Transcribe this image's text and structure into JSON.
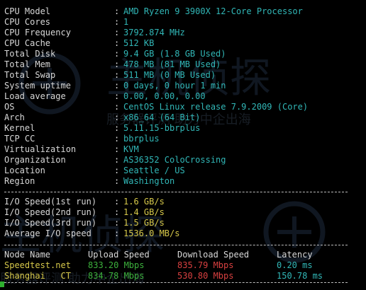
{
  "colors": {
    "background": "#000000",
    "label": "#d8d8d8",
    "value_cyan": "#31b7b7",
    "value_yellow": "#d6c84a",
    "value_green": "#3cb03c",
    "value_red": "#d84040"
  },
  "sysinfo": [
    {
      "label": "CPU Model",
      "value": "AMD Ryzen 9 3900X 12-Core Processor"
    },
    {
      "label": "CPU Cores",
      "value": "1"
    },
    {
      "label": "CPU Frequency",
      "value": "3792.874 MHz"
    },
    {
      "label": "CPU Cache",
      "value": "512 KB"
    },
    {
      "label": "Total Disk",
      "value": "9.4 GB (1.8 GB Used)"
    },
    {
      "label": "Total Mem",
      "value": "478 MB (81 MB Used)"
    },
    {
      "label": "Total Swap",
      "value": "511 MB (0 MB Used)"
    },
    {
      "label": "System uptime",
      "value": "0 days, 0 hour 1 min"
    },
    {
      "label": "Load average",
      "value": "0.00, 0.00, 0.00"
    },
    {
      "label": "OS",
      "value": "CentOS Linux release 7.9.2009 (Core)"
    },
    {
      "label": "Arch",
      "value": "x86_64 (64 Bit)"
    },
    {
      "label": "Kernel",
      "value": "5.11.15-bbrplus"
    },
    {
      "label": "TCP CC",
      "value": "bbrplus"
    },
    {
      "label": "Virtualization",
      "value": "KVM"
    },
    {
      "label": "Organization",
      "value": "AS36352 ColoCrossing"
    },
    {
      "label": "Location",
      "value": "Seattle / US"
    },
    {
      "label": "Region",
      "value": "Washington"
    }
  ],
  "separator": ":",
  "io": [
    {
      "label": "I/O Speed(1st run)",
      "value": "1.6 GB/s"
    },
    {
      "label": "I/O Speed(2nd run)",
      "value": "1.4 GB/s"
    },
    {
      "label": "I/O Speed(3rd run)",
      "value": "1.5 GB/s"
    },
    {
      "label": "Average I/O speed",
      "value": "1536.0 MB/s"
    }
  ],
  "speedtest": {
    "headers": {
      "node": "Node Name",
      "upload": "Upload Speed",
      "download": "Download Speed",
      "latency": "Latency"
    },
    "rows": [
      {
        "node": "Speedtest.net",
        "upload": "833.20 Mbps",
        "download": "835.79 Mbps",
        "latency": "0.20 ms"
      },
      {
        "node": "Shanghai   CT",
        "upload": "834.78 Mbps",
        "download": "530.80 Mbps",
        "latency": "150.78 ms"
      }
    ]
  },
  "watermark": {
    "line1": "主机侦探",
    "line2": "服务器评测 助力中企出海"
  }
}
